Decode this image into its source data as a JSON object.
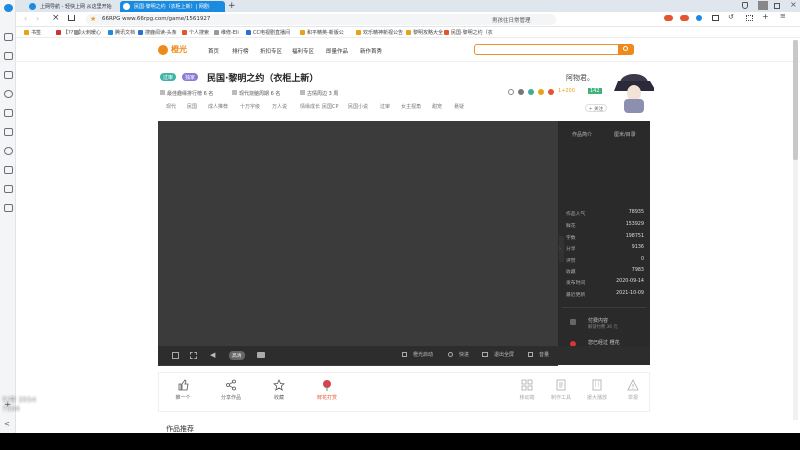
{
  "browser": {
    "tabs": [
      {
        "label": "上网导航 - 轻快上网 从这里开始",
        "active": false
      },
      {
        "label": "民国·黎明之约（衣柜上新）| 网剧·",
        "active": true
      }
    ],
    "address": "66RPG   www.66rpg.com/game/1561927",
    "address_right": "男孩往日常管理",
    "bookmarks": [
      "书签",
      "【????】",
      "火刺暖心",
      "腾讯文档",
      "搜鹿阅读-头条",
      "个人搜索",
      "维修-Eli",
      "CC电视剧直播间",
      "和平精英-新版公",
      "欢乐精神新视公告",
      "黎明攻略大全",
      "民国·黎明之约（衣"
    ]
  },
  "site": {
    "logo": "橙光",
    "nav": [
      "首页",
      "排行榜",
      "折扣专区",
      "福利专区",
      "即量作品",
      "新作首秀"
    ],
    "tags": [
      "过审",
      "独家"
    ],
    "title": "民国·黎明之约（衣柜上新）",
    "author": "阿物君。",
    "follow": "+ 关注",
    "meta": [
      "最佳趣缘排行榜 6 名",
      "现代烧脑周期 6 名",
      "古情周边 3 周"
    ],
    "sub_tabs": [
      "现代",
      "民国",
      "成人推荐",
      "十万字级",
      "万人说",
      "情缘成长",
      "民国CP",
      "民国小说",
      "过审",
      "女主视角",
      "甜宠",
      "悬疑"
    ],
    "fresh_badge": "1+200",
    "vip_badge": "142"
  },
  "panel": {
    "tabs": [
      "作品简介",
      "厘米/目录"
    ],
    "stats": [
      {
        "label": "作品人气",
        "value": "78935"
      },
      {
        "label": "鲜花",
        "value": "153929"
      },
      {
        "label": "字数",
        "value": "198751"
      },
      {
        "label": "分享",
        "value": "9136"
      },
      {
        "label": "评赞",
        "value": "0"
      },
      {
        "label": "收藏",
        "value": "7983"
      },
      {
        "label": "发布时间",
        "value": "2020-09-14"
      },
      {
        "label": "最近更新",
        "value": "2021-10-09"
      }
    ],
    "notices": [
      {
        "title": "付费内容",
        "sub": "解锁付费 36 元"
      },
      {
        "title": "您已经过 橙花",
        "sub": "分享超值 0 元"
      }
    ]
  },
  "controls": {
    "speed": "高清",
    "right": [
      "橙光启动",
      "快进",
      "退出全屏",
      "音量"
    ]
  },
  "actions_left": [
    "推一个",
    "分享作品",
    "收藏",
    "鲜花打赏"
  ],
  "actions_right": [
    "移动端",
    "制作工具",
    "援大播放",
    "举报"
  ],
  "section_title": "作品推荐",
  "watermark": "引导 3554 7504"
}
